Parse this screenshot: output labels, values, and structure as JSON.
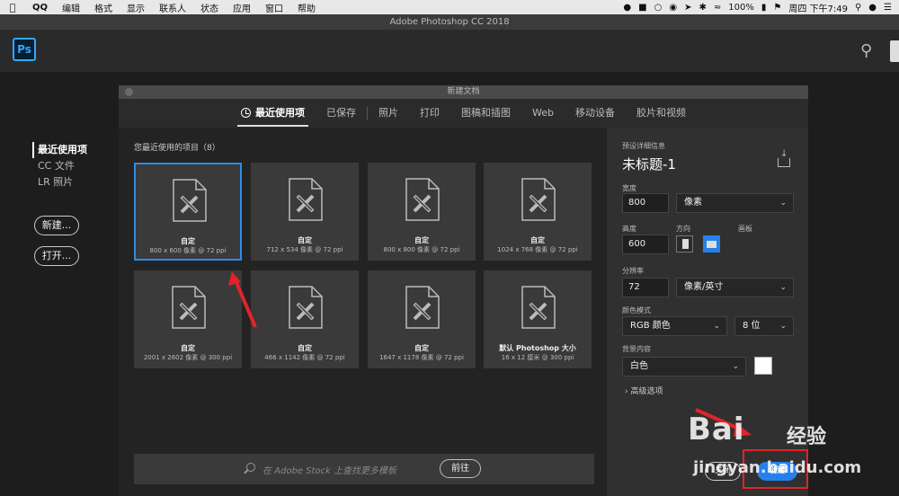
{
  "menubar": {
    "apple": "",
    "items": [
      "QQ",
      "编辑",
      "格式",
      "显示",
      "联系人",
      "状态",
      "应用",
      "窗口",
      "帮助"
    ],
    "battery": "100%",
    "clock": "周四 下午7:49"
  },
  "app": {
    "title": "Adobe Photoshop CC 2018",
    "logo": "Ps"
  },
  "start_nav": {
    "items": [
      "最近使用项",
      "CC 文件",
      "LR 照片"
    ],
    "new_button": "新建...",
    "open_button": "打开..."
  },
  "dialog": {
    "title": "新建文档",
    "tabs": [
      "最近使用项",
      "已保存",
      "照片",
      "打印",
      "图稿和插图",
      "Web",
      "移动设备",
      "胶片和视频"
    ],
    "recent_heading": "您最近使用的项目（8）",
    "recent_items": [
      {
        "name": "自定",
        "size": "800 x 600 像素 @ 72 ppi"
      },
      {
        "name": "自定",
        "size": "712 x 534 像素 @ 72 ppi"
      },
      {
        "name": "自定",
        "size": "800 x 800 像素 @ 72 ppi"
      },
      {
        "name": "自定",
        "size": "1024 x 768 像素 @ 72 ppi"
      },
      {
        "name": "自定",
        "size": "2001 x 2602 像素 @ 300 ppi"
      },
      {
        "name": "自定",
        "size": "466 x 1142 像素 @ 72 ppi"
      },
      {
        "name": "自定",
        "size": "1647 x 1178 像素 @ 72 ppi"
      },
      {
        "name": "默认 Photoshop 大小",
        "size": "16 x 12 厘米 @ 300 ppi"
      }
    ],
    "stock_search_placeholder": "在 Adobe Stock 上查找更多模板",
    "stock_go": "前往"
  },
  "details": {
    "heading": "预设详细信息",
    "doc_name": "未标题-1",
    "width_label": "宽度",
    "width_value": "800",
    "width_unit": "像素",
    "height_label": "高度",
    "height_value": "600",
    "orientation_label": "方向",
    "artboard_label": "画板",
    "resolution_label": "分辨率",
    "resolution_value": "72",
    "resolution_unit": "像素/英寸",
    "color_mode_label": "颜色模式",
    "color_mode": "RGB 颜色",
    "bit_depth": "8 位",
    "background_label": "背景内容",
    "background": "白色",
    "background_color": "#ffffff",
    "advanced": "高级选项",
    "close_button": "关闭",
    "create_button": "创建"
  },
  "watermark": {
    "brand": "Bai",
    "brand2": "经验",
    "url": "jingyan.baidu.com"
  },
  "colors": {
    "accent": "#2680eb",
    "selection": "#2f8bea",
    "annotation": "#e0242a"
  }
}
